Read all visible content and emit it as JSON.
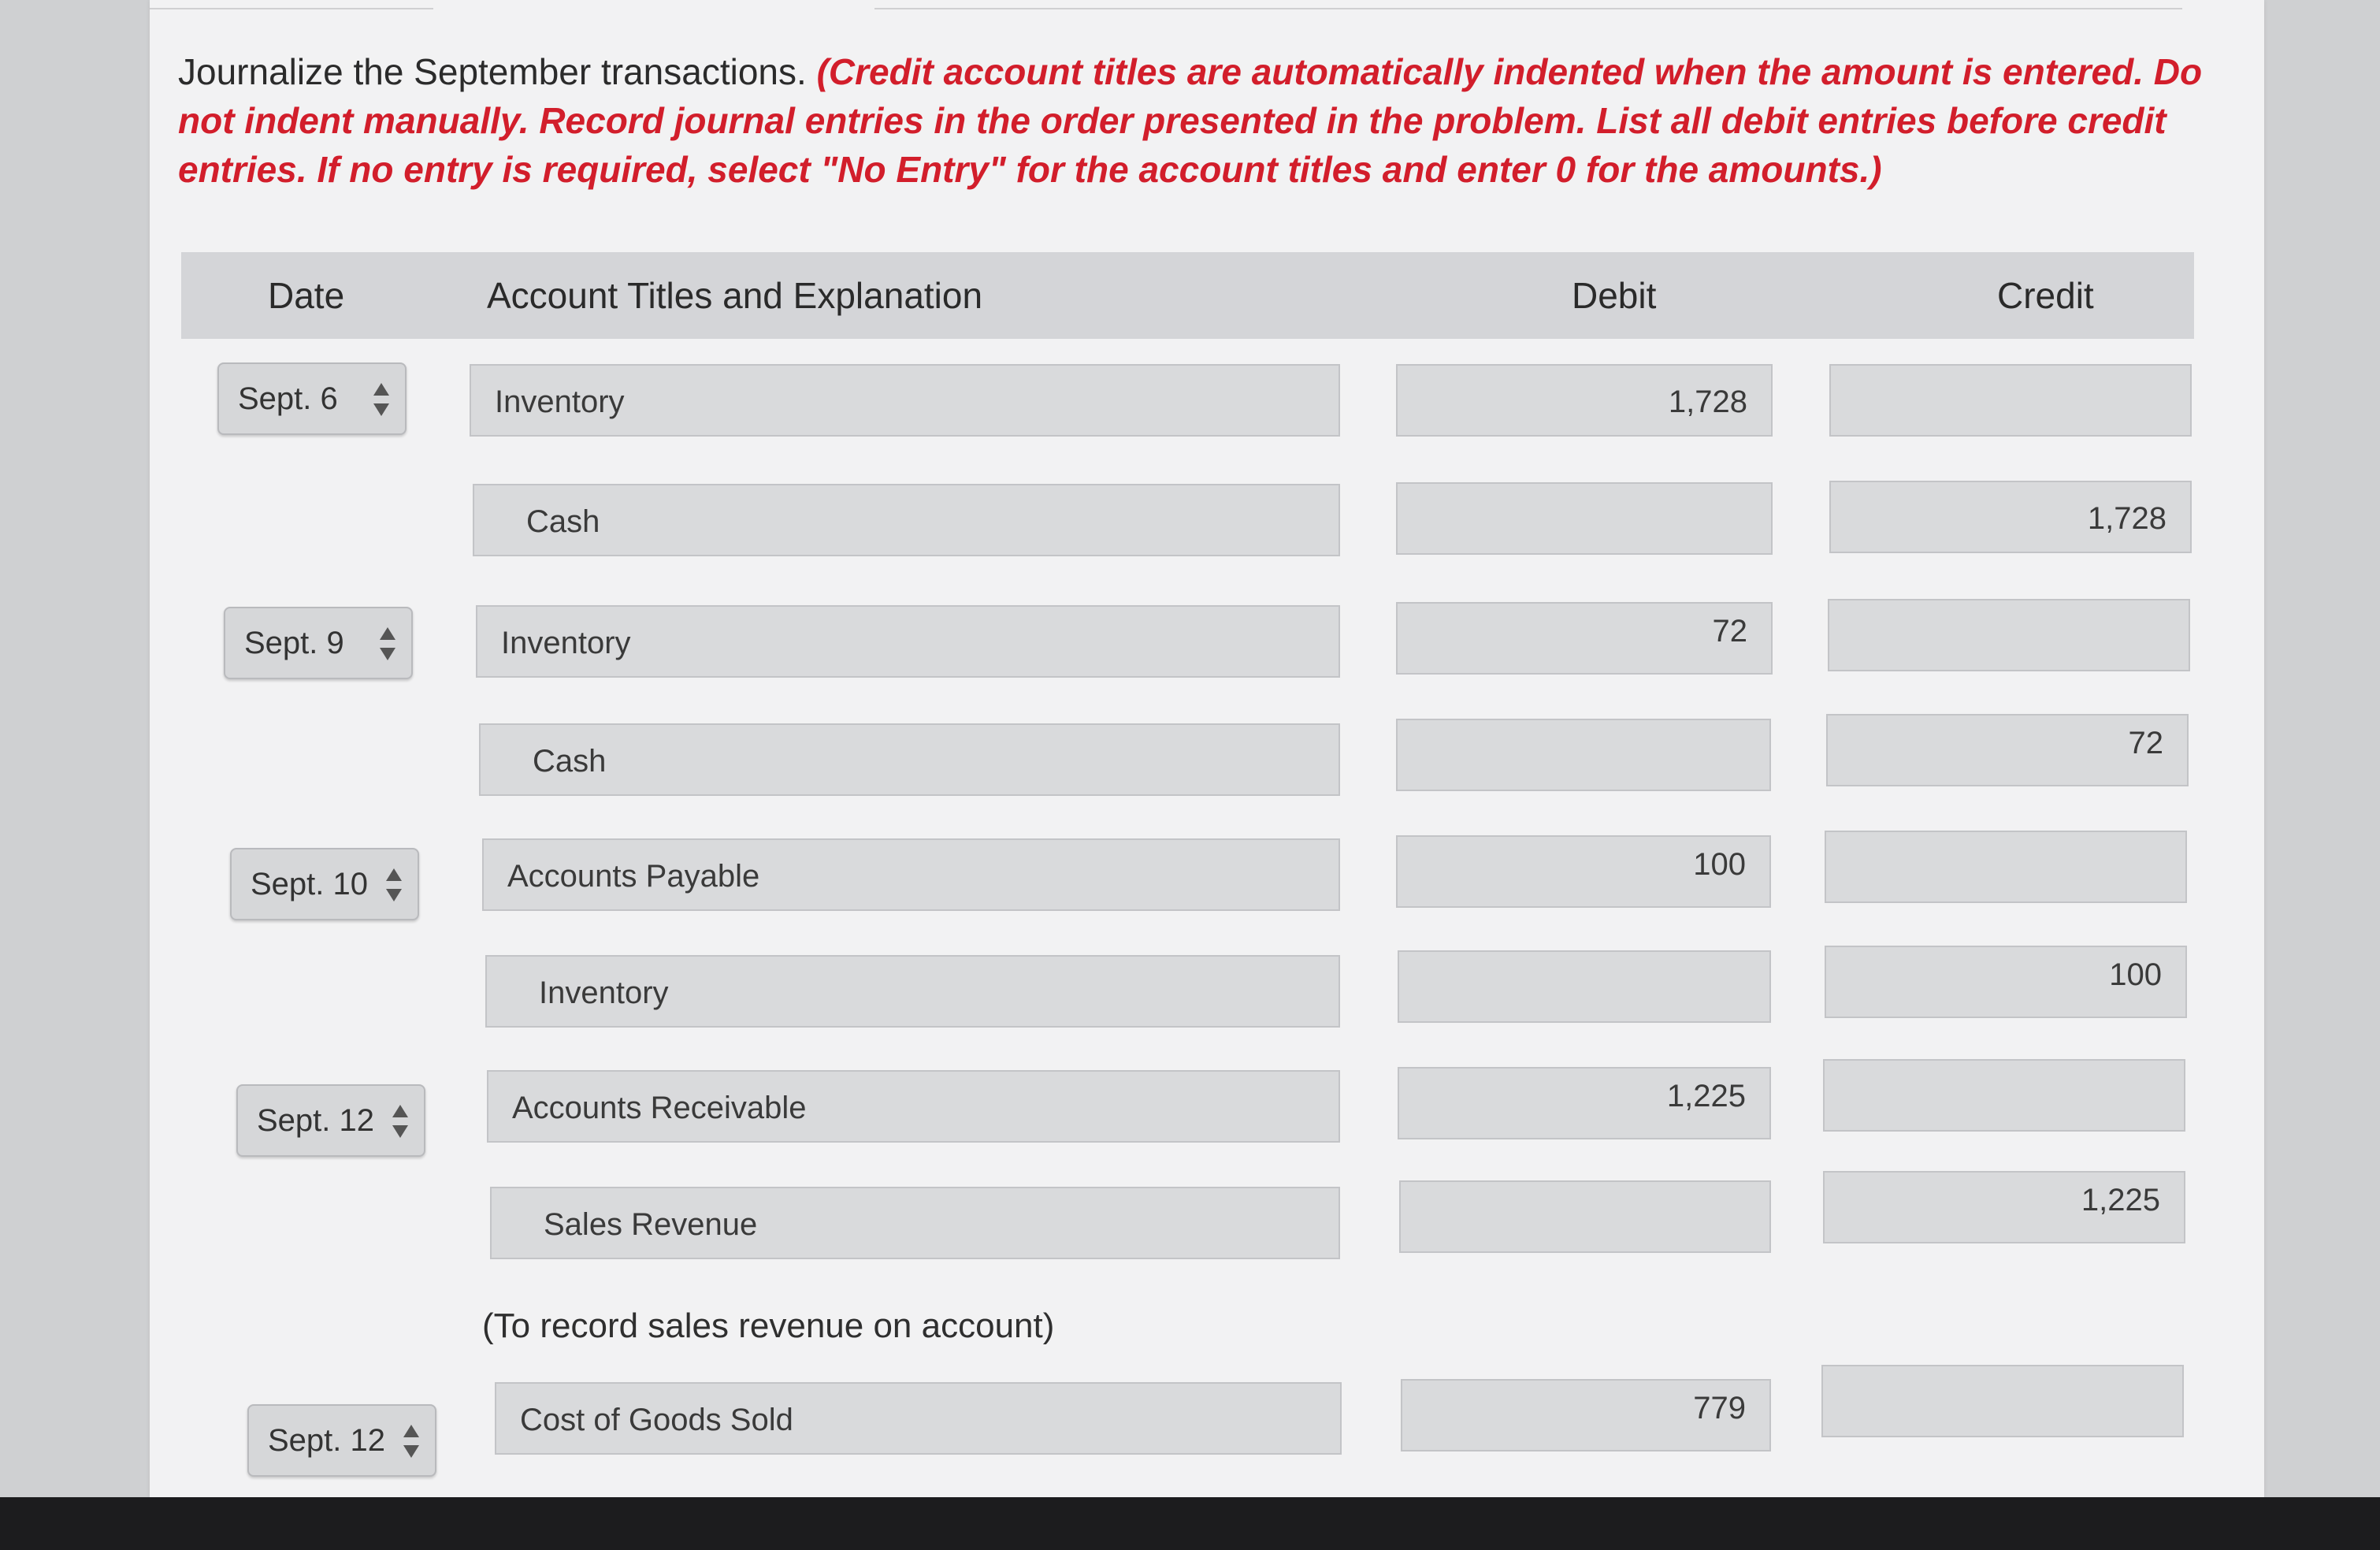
{
  "instructions": {
    "lead": "Journalize the September transactions.",
    "note": "(Credit account titles are automatically indented when the amount is entered. Do not indent manually. Record journal entries in the order presented in the problem. List all debit entries before credit entries. If no entry is required, select \"No Entry\" for the account titles and enter 0 for the amounts.)"
  },
  "table": {
    "headers": {
      "date": "Date",
      "account": "Account Titles and Explanation",
      "debit": "Debit",
      "credit": "Credit"
    }
  },
  "rows": [
    {
      "date": "Sept. 6",
      "account": "Inventory",
      "debit": "1,728",
      "credit": ""
    },
    {
      "date": "",
      "account": "Cash",
      "debit": "",
      "credit": "1,728"
    },
    {
      "date": "Sept. 9",
      "account": "Inventory",
      "debit": "72",
      "credit": ""
    },
    {
      "date": "",
      "account": "Cash",
      "debit": "",
      "credit": "72"
    },
    {
      "date": "Sept. 10",
      "account": "Accounts Payable",
      "debit": "100",
      "credit": ""
    },
    {
      "date": "",
      "account": "Inventory",
      "debit": "",
      "credit": "100"
    },
    {
      "date": "Sept. 12",
      "account": "Accounts Receivable",
      "debit": "1,225",
      "credit": ""
    },
    {
      "date": "",
      "account": "Sales Revenue",
      "debit": "",
      "credit": "1,225"
    },
    {
      "date": "Sept. 12",
      "account": "Cost of Goods Sold",
      "debit": "779",
      "credit": ""
    }
  ],
  "explanations": {
    "sept12_sales": "(To record sales revenue on account)"
  }
}
